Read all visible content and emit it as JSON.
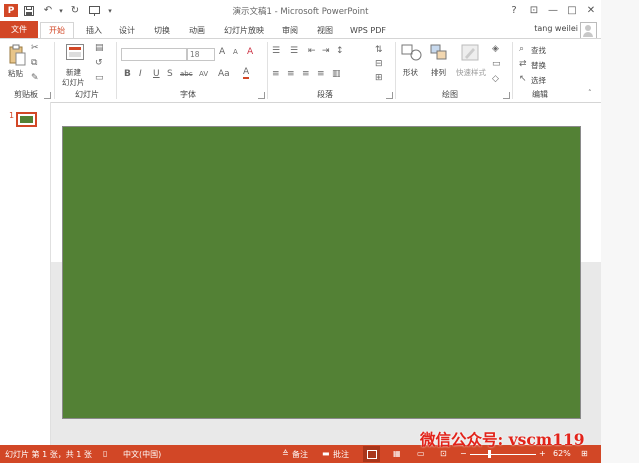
{
  "window": {
    "title": "演示文稿1 - Microsoft PowerPoint",
    "help": "?",
    "controls": {
      "ribbon_options": "⊡",
      "minimize": "—",
      "maximize": "□",
      "close": "✕"
    }
  },
  "qat": {
    "app_icon": "P",
    "save_icon": "floppy-icon",
    "undo_icon": "undo-icon",
    "redo_icon": "redo-icon",
    "present_icon": "present-icon",
    "customize_icon": "chevron-down-icon"
  },
  "tabs": [
    {
      "label": "文件"
    },
    {
      "label": "开始"
    },
    {
      "label": "插入"
    },
    {
      "label": "设计"
    },
    {
      "label": "切换"
    },
    {
      "label": "动画"
    },
    {
      "label": "幻灯片放映"
    },
    {
      "label": "审阅"
    },
    {
      "label": "视图"
    },
    {
      "label": "WPS PDF"
    }
  ],
  "user": {
    "name": "tang weilei"
  },
  "ribbon": {
    "clipboard": {
      "paste": "粘贴",
      "label": "剪贴板"
    },
    "slides": {
      "new_slide_1": "新建",
      "new_slide_2": "幻灯片",
      "label": "幻灯片"
    },
    "font": {
      "size": "18",
      "bold": "B",
      "italic": "I",
      "underline": "U",
      "shadow": "S",
      "strike": "abc",
      "spacing": "AV",
      "case": "Aa",
      "color": "A",
      "clear": "A",
      "grow": "A",
      "shrink": "A",
      "label": "字体"
    },
    "paragraph": {
      "label": "段落"
    },
    "drawing": {
      "shapes": "形状",
      "arrange": "排列",
      "quick_styles": "快速样式",
      "label": "绘图"
    },
    "editing": {
      "find": "查找",
      "replace": "替换",
      "select": "选择",
      "label": "编辑"
    }
  },
  "thumbnails": [
    {
      "number": "1"
    }
  ],
  "slide": {
    "background": "#538135"
  },
  "status": {
    "slide_info": "幻灯片 第 1 张，共 1 张",
    "language": "中文(中国)",
    "notes": "备注",
    "comments": "批注",
    "zoom": "62%",
    "zoom_minus": "−",
    "zoom_plus": "+"
  },
  "watermark": "微信公众号: vscm119",
  "colors": {
    "accent": "#d24726",
    "slide": "#538135"
  }
}
